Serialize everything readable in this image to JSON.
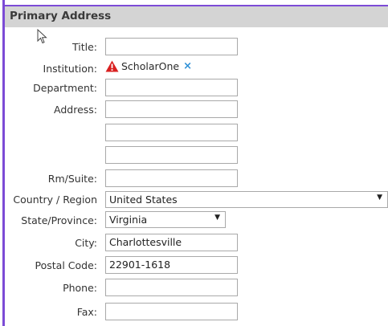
{
  "section": {
    "title": "Primary Address"
  },
  "fields": {
    "title": {
      "label": "Title:",
      "value": ""
    },
    "institution": {
      "label": "Institution:",
      "value": "ScholarOne",
      "warning_icon": "warning-icon",
      "remove_icon": "close-icon",
      "remove_glyph": "×"
    },
    "department": {
      "label": "Department:",
      "value": ""
    },
    "address": {
      "label": "Address:",
      "line1": "",
      "line2": "",
      "line3": ""
    },
    "rm_suite": {
      "label": "Rm/Suite:",
      "value": ""
    },
    "country": {
      "label": "Country / Region",
      "value": "United States"
    },
    "state": {
      "label": "State/Province:",
      "value": "Virginia"
    },
    "city": {
      "label": "City:",
      "value": "Charlottesville"
    },
    "postal_code": {
      "label": "Postal Code:",
      "value": "22901-1618"
    },
    "phone": {
      "label": "Phone:",
      "value": ""
    },
    "fax": {
      "label": "Fax:",
      "value": ""
    }
  },
  "colors": {
    "frame_border": "#7c4bd6",
    "header_bg": "#d4d4d4",
    "warning_red": "#d92020",
    "remove_blue": "#2c8fd6"
  }
}
